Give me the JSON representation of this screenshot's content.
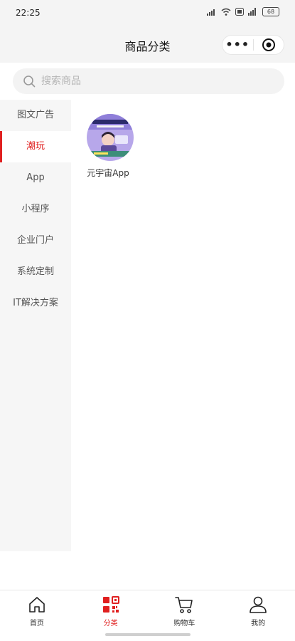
{
  "status_bar": {
    "time": "22:25",
    "battery": "68"
  },
  "navbar": {
    "title": "商品分类",
    "more_icon": "more-dots-icon",
    "capsule_icon": "target-icon"
  },
  "search": {
    "placeholder": "搜索商品",
    "icon": "search-icon"
  },
  "sidebar": {
    "items": [
      {
        "label": "图文广告",
        "active": false
      },
      {
        "label": "潮玩",
        "active": true
      },
      {
        "label": "App",
        "active": false
      },
      {
        "label": "小程序",
        "active": false
      },
      {
        "label": "企业门户",
        "active": false
      },
      {
        "label": "系统定制",
        "active": false
      },
      {
        "label": "IT解决方案",
        "active": false
      }
    ]
  },
  "products": [
    {
      "label": "元宇宙App"
    }
  ],
  "tabbar": {
    "items": [
      {
        "label": "首页",
        "icon": "home-icon",
        "active": false
      },
      {
        "label": "分类",
        "icon": "category-icon",
        "active": true
      },
      {
        "label": "购物车",
        "icon": "cart-icon",
        "active": false
      },
      {
        "label": "我的",
        "icon": "user-icon",
        "active": false
      }
    ]
  },
  "colors": {
    "accent": "#e02020",
    "sidebar_bg": "#f6f6f6",
    "header_bg": "#f4f4f4"
  }
}
